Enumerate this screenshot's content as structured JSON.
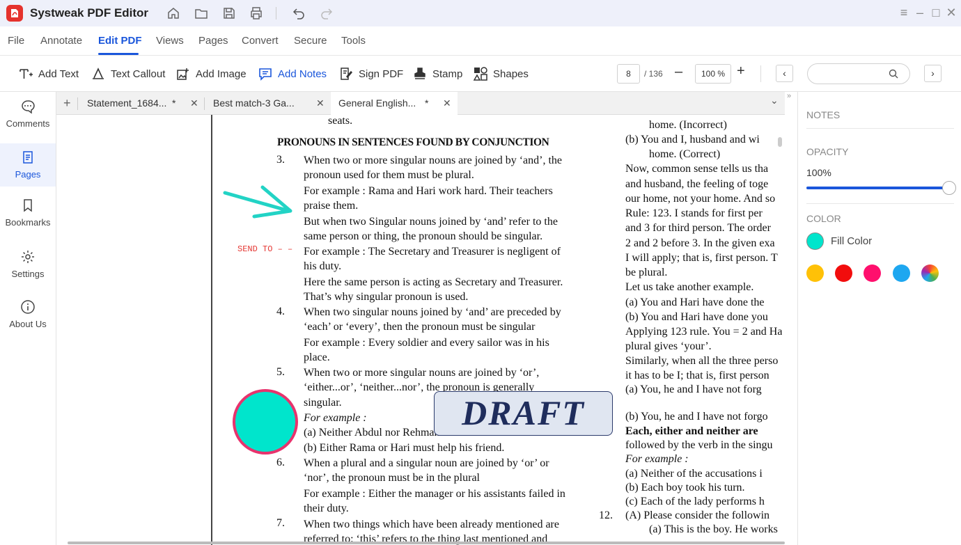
{
  "app": {
    "title": "Systweak PDF Editor"
  },
  "menu": {
    "items": [
      "File",
      "Annotate",
      "Edit PDF",
      "Views",
      "Pages",
      "Convert",
      "Secure",
      "Tools"
    ],
    "active": "Edit PDF"
  },
  "toolbar": {
    "add_text": "Add Text",
    "text_callout": "Text Callout",
    "add_image": "Add Image",
    "add_notes": "Add Notes",
    "sign_pdf": "Sign PDF",
    "stamp": "Stamp",
    "shapes": "Shapes",
    "page_current": "8",
    "page_total": "/ 136",
    "zoom": "100 %",
    "zoom_minus": "–",
    "zoom_plus": "+",
    "search_placeholder": ""
  },
  "sidebar": {
    "items": [
      "Comments",
      "Pages",
      "Bookmarks",
      "Settings",
      "About Us"
    ],
    "active": "Pages"
  },
  "tabs": [
    {
      "label": "Statement_1684...",
      "modified": "*"
    },
    {
      "label": "Best match-3 Ga...",
      "modified": ""
    },
    {
      "label": "General English...",
      "modified": "*"
    }
  ],
  "document": {
    "left": [
      "seats.",
      "PRONOUNS IN SENTENCES FOUND BY CONJUNCTION",
      "When two or more singular nouns are joined by ‘and’, the",
      "pronoun used for them must be plural.",
      "For example : Rama and Hari work hard. Their teachers",
      "praise them.",
      "But when two Singular nouns joined by ‘and’ refer to the",
      "same person or thing, the pronoun should be singular.",
      "For example : The Secretary and Treasurer is negligent of",
      "his duty.",
      "Here the same person is acting as Secretary and Treasurer.",
      "That’s why singular pronoun is used.",
      "When two singular nouns joined by ‘and’ are preceded by",
      "‘each’ or ‘every’, then the pronoun must be singular",
      "For example : Every soldier and every sailor was in his",
      "place.",
      "When two or more singular nouns are joined by ‘or’,",
      "‘either...or’, ‘neither...nor’, the pronoun is generally",
      "singular.",
      "For example :",
      "(a)   Neither Abdul nor Rehman has done his lessons.",
      "(b)   Either Rama or Hari must help his friend.",
      "When a plural and a singular noun are joined by ‘or’ or",
      "‘nor’, the pronoun must be in the plural",
      "For example : Either the manager or his assistants failed in",
      "their duty.",
      "When two things which have been already mentioned are",
      "referred to: ‘this’ refers to the thing last mentioned and"
    ],
    "numbers": [
      "3.",
      "4.",
      "5.",
      "6.",
      "7.",
      "12."
    ],
    "right": [
      "home. (Incorrect)",
      "(b)   You and I, husband and wi",
      "home. (Correct)",
      "Now, common sense tells us tha",
      "and husband, the feeling of toge",
      "our home, not your home. And so",
      "Rule: 123. I stands for first per",
      "and 3 for third person. The order",
      "2 and 2 before 3. In the given exa",
      "I will apply; that is, first person. T",
      "be plural.",
      "Let us take another example.",
      "(a)   You and Hari have done the",
      "(b)   You and Hari have done you",
      "Applying 123 rule. You = 2 and Ha",
      "plural gives ‘your’.",
      "Similarly, when all the three perso",
      "it has to be I; that is, first person",
      "(a)   You, he and I have not forg",
      "(b)   You, he and I have not forgo",
      "Each, either and neither are",
      "followed by the verb in the singu",
      "For example :",
      "(a)   Neither of the accusations i",
      "(b)   Each boy took his turn.",
      "(c)   Each of the lady performs h",
      "(A)  Please consider the followin",
      "(a)   This is the boy. He works"
    ],
    "annotation_text": "SEND TO – –",
    "stamp_text": "DRAFT"
  },
  "right_panel": {
    "notes_label": "NOTES",
    "opacity_label": "OPACITY",
    "opacity_value": "100%",
    "opacity_fraction": 1.0,
    "color_label": "COLOR",
    "fill_color_label": "Fill Color",
    "fill_color": "#00e5cc",
    "swatches": [
      "#ffc107",
      "#f20d0d",
      "#ff0f6d",
      "#1ea7f0",
      "multicolor"
    ]
  },
  "colors": {
    "accent": "#1a56db",
    "titlebar": "#eef0fa"
  }
}
